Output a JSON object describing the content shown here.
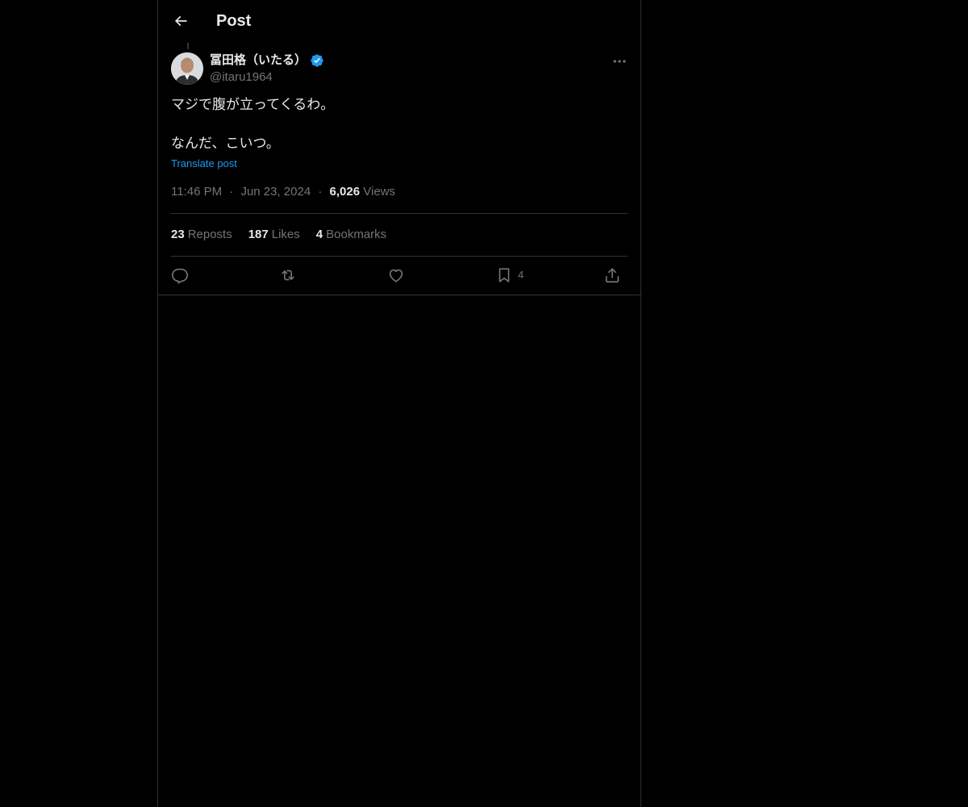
{
  "header": {
    "title": "Post",
    "back_icon": "arrow-left-icon"
  },
  "author": {
    "display_name": "冨田格（いたる）",
    "handle": "@itaru1964",
    "verified": true,
    "verified_color": "#1d9bf0"
  },
  "tweet": {
    "text": "マジで腹が立ってくるわ。\n\nなんだ、こいつ。",
    "translate_label": "Translate post",
    "time": "11:46 PM",
    "separator": "·",
    "date": "Jun 23, 2024",
    "views_count": "6,026",
    "views_label": "Views"
  },
  "stats": [
    {
      "count": "23",
      "label": "Reposts"
    },
    {
      "count": "187",
      "label": "Likes"
    },
    {
      "count": "4",
      "label": "Bookmarks"
    }
  ],
  "actions": {
    "reply_icon": "reply-icon",
    "repost_icon": "repost-icon",
    "like_icon": "heart-icon",
    "bookmark_icon": "bookmark-icon",
    "bookmark_count": "4",
    "share_icon": "share-icon"
  },
  "colors": {
    "background": "#000000",
    "text": "#e7e9ea",
    "muted": "#71767b",
    "link": "#1d9bf0",
    "border": "#2f3336"
  }
}
